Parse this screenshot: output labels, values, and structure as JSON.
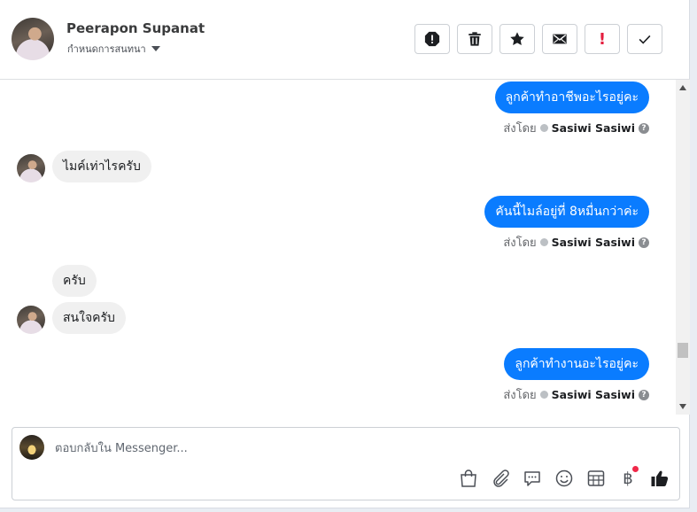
{
  "header": {
    "contact_name": "Peerapon Supanat",
    "label_dropdown": "กำหนดการสนทนา",
    "actions": [
      {
        "icon": "alert-circle-icon",
        "name": "mark-spam-button"
      },
      {
        "icon": "trash-icon",
        "name": "delete-button"
      },
      {
        "icon": "star-icon",
        "name": "star-button"
      },
      {
        "icon": "envelope-icon",
        "name": "mark-unread-button"
      },
      {
        "icon": "exclamation-icon",
        "name": "follow-up-button",
        "text": "!"
      },
      {
        "icon": "check-icon",
        "name": "mark-done-button"
      }
    ]
  },
  "messages": [
    {
      "dir": "out",
      "text": "ลูกค้าทำอาชีพอะไรอยู่คะ",
      "sent_by_label": "ส่งโดย",
      "agent": "Sasiwi Sasiwi"
    },
    {
      "dir": "in",
      "text": "ไมค์เท่าไรครับ"
    },
    {
      "dir": "out",
      "text": "คันนี้ไมล์อยู่ที่ 8หมื่นกว่าค่ะ",
      "sent_by_label": "ส่งโดย",
      "agent": "Sasiwi Sasiwi"
    },
    {
      "dir": "in",
      "text": "ครับ"
    },
    {
      "dir": "in",
      "text": "สนใจครับ"
    },
    {
      "dir": "out",
      "text": "ลูกค้าทำงานอะไรอยู่คะ",
      "sent_by_label": "ส่งโดย",
      "agent": "Sasiwi Sasiwi"
    }
  ],
  "composer": {
    "placeholder": "ตอบกลับใน Messenger...",
    "value": "",
    "tools": [
      "shopping-bag-icon",
      "paperclip-icon",
      "saved-reply-icon",
      "emoji-icon",
      "appointment-icon",
      "payment-baht-icon",
      "thumbs-up-icon"
    ],
    "baht_symbol": "฿",
    "help_symbol": "?"
  },
  "colors": {
    "outgoing_bubble": "#0a7cff",
    "incoming_bubble": "#f0f0f0",
    "notification_dot": "#f02849",
    "follow_up_red": "#e41e3f"
  }
}
